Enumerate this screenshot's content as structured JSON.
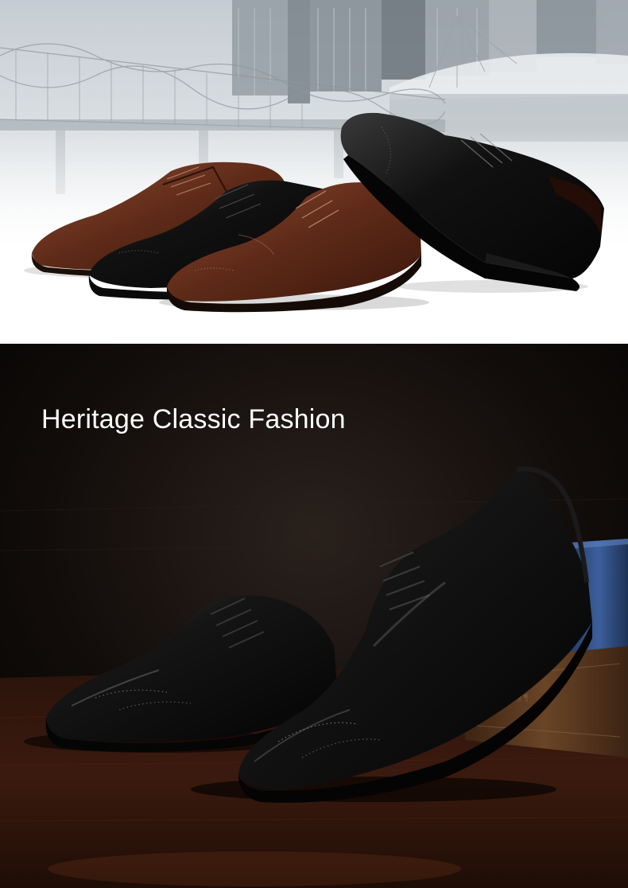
{
  "top_panel": {
    "description_icons": [
      "city-skyline-image",
      "dress-shoes-image"
    ],
    "colors": {
      "sky": "#cfd6dc",
      "brown_leather": "#6b3220",
      "black_leather": "#0d0d0d"
    }
  },
  "bottom_panel": {
    "headline": "Heritage Classic Fashion",
    "colors": {
      "background": "#0a0706",
      "headline": "#ffffff",
      "table": "#3a1a10",
      "book_blue": "#2f4f86"
    }
  }
}
